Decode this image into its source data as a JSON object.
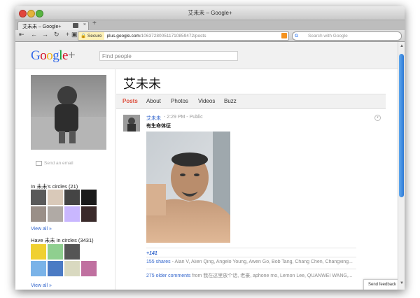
{
  "window": {
    "title": "艾未未 – Google+"
  },
  "tab": {
    "title": "艾未未 – Google+",
    "close": "×",
    "new_tab": "+"
  },
  "toolbar": {
    "back": "⇤",
    "back2": "←",
    "forward": "→",
    "reload": "↻",
    "add": "+",
    "sidebar": "▣",
    "secure_label": "Secure",
    "url_domain": "plus.google.com",
    "url_path": "/106372800511710859472/posts",
    "search_placeholder": "Search with Google",
    "search_engine": "G"
  },
  "gplus": {
    "logo_letters": [
      {
        "ch": "G",
        "color": "#3369e8"
      },
      {
        "ch": "o",
        "color": "#d50f25"
      },
      {
        "ch": "o",
        "color": "#eeb211"
      },
      {
        "ch": "g",
        "color": "#3369e8"
      },
      {
        "ch": "l",
        "color": "#009925"
      },
      {
        "ch": "e",
        "color": "#d50f25"
      },
      {
        "ch": "+",
        "color": "#666666"
      }
    ],
    "find_people_placeholder": "Find people"
  },
  "profile": {
    "name": "艾未未",
    "send_email": "Send an email",
    "in_circles": "In 未未's circles (21)",
    "have_circles": "Have 未未 in circles (3431)",
    "view_all": "View all »"
  },
  "profile_tabs": [
    "Posts",
    "About",
    "Photos",
    "Videos",
    "Buzz"
  ],
  "post": {
    "author": "艾未未",
    "time": "2:29 PM",
    "visibility": "Public",
    "meta_sep": "  -  ",
    "text": "有生命体征",
    "plus_one": "+1",
    "plus_one_count": "41",
    "shares_link": "155 shares",
    "shares_names": " - Alan V, Alien Qing, Angelo Young, Awen Go, Bob Tang, Chang Chen, Changxing...",
    "comments_link": "275 older comments",
    "comments_names": " from 我在这里放个话, 老豪, aphone mo, Lemon Lee, QUANWEI WANG,..."
  },
  "feedback": "Send feedback",
  "colors": {
    "accent": "#dd4b39",
    "link": "#3366cc",
    "scroll_thumb": "#2e7ad6"
  }
}
